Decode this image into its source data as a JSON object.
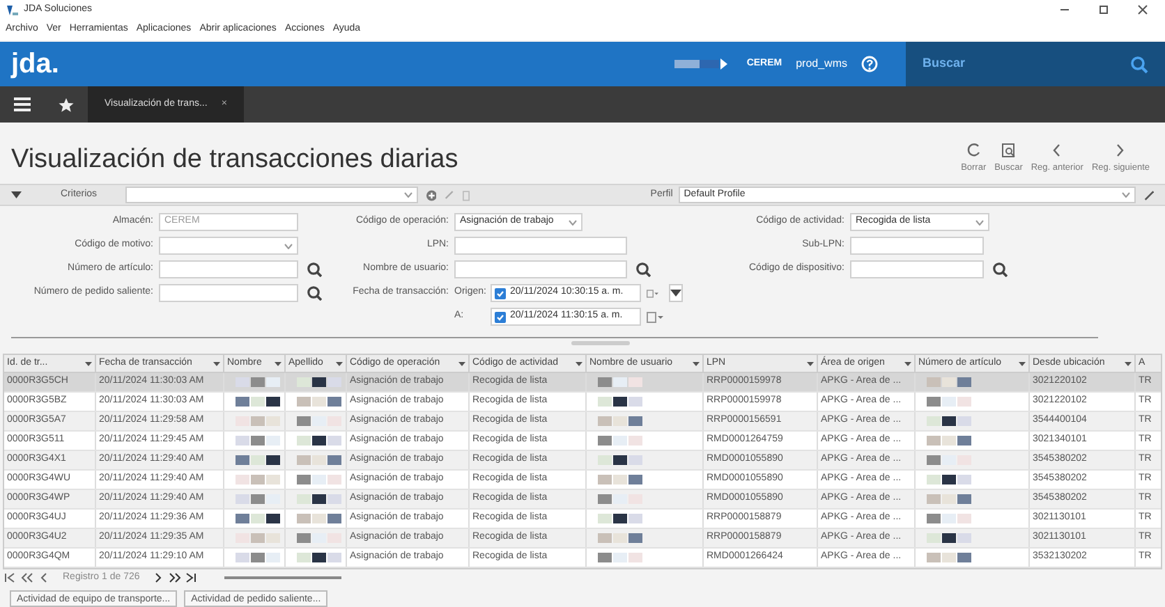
{
  "window": {
    "title": "JDA Soluciones"
  },
  "menu": [
    "Archivo",
    "Ver",
    "Herramientas",
    "Aplicaciones",
    "Abrir aplicaciones",
    "Acciones",
    "Ayuda"
  ],
  "header": {
    "logo": "jda.",
    "warehouse": "CEREM",
    "environment": "prod_wms",
    "search_label": "Buscar"
  },
  "tabs": [
    {
      "label": "Visualización de trans...",
      "close": "×",
      "selected": true
    }
  ],
  "page": {
    "title": "Visualización de transacciones diarias",
    "actions": [
      {
        "label": "Borrar",
        "kind": "clear"
      },
      {
        "label": "Buscar",
        "kind": "find"
      },
      {
        "label": "Reg. anterior",
        "kind": "prev"
      },
      {
        "label": "Reg. siguiente",
        "kind": "next"
      }
    ]
  },
  "criteria": {
    "label": "Criterios",
    "profile_label": "Perfil",
    "profile": "Default Profile"
  },
  "form": [
    [
      {
        "kind": "text",
        "label": "Almacén:",
        "value": "CEREM",
        "disabled": true
      },
      {
        "kind": "select",
        "label": "Código de motivo:"
      },
      {
        "kind": "lookup",
        "label": "Número de artículo:"
      },
      {
        "kind": "lookup",
        "label": "Número de pedido saliente:"
      }
    ],
    [
      {
        "kind": "select",
        "label": "Código de operación:",
        "value": "Asignación de trabajo"
      },
      {
        "kind": "text",
        "label": "LPN:"
      },
      {
        "kind": "lookup",
        "label": "Nombre de usuario:"
      },
      {
        "kind": "date",
        "label": "Fecha de transacción:",
        "prefix": "Origen:",
        "value": "20/11/2024 10:30:15 a. m.",
        "checked": true,
        "expander": true
      },
      {
        "kind": "date",
        "prefix": "A:",
        "value": "20/11/2024 11:30:15 a. m.",
        "checked": true
      }
    ],
    [
      {
        "kind": "select",
        "label": "Código de actividad:",
        "value": "Recogida de lista"
      },
      {
        "kind": "text",
        "label": "Sub-LPN:"
      },
      {
        "kind": "lookup",
        "label": "Código de dispositivo:"
      }
    ]
  ],
  "grid": {
    "columns": [
      {
        "label": "Id. de tr...",
        "kind": "text"
      },
      {
        "label": "Fecha de transacción",
        "kind": "text"
      },
      {
        "label": "Nombre",
        "kind": "redacted"
      },
      {
        "label": "Apellido",
        "kind": "redacted"
      },
      {
        "label": "Código de operación",
        "kind": "text"
      },
      {
        "label": "Código de actividad",
        "kind": "text"
      },
      {
        "label": "Nombre de usuario",
        "kind": "redacted"
      },
      {
        "label": "LPN",
        "kind": "text"
      },
      {
        "label": "Área de origen",
        "kind": "text"
      },
      {
        "label": "Número de artículo",
        "kind": "redacted"
      },
      {
        "label": "Desde ubicación",
        "kind": "text"
      },
      {
        "label": "A",
        "kind": "text"
      }
    ],
    "rows": [
      {
        "selected": true,
        "cells": [
          "0000R3G5CH",
          "20/11/2024 11:30:03 AM",
          "",
          "",
          "Asignación de trabajo",
          "Recogida de lista",
          "",
          "RRP0000159978",
          "APKG - Area de ...",
          "",
          "3021220102",
          "TR"
        ]
      },
      {
        "selected": false,
        "cells": [
          "0000R3G5BZ",
          "20/11/2024 11:30:03 AM",
          "",
          "",
          "Asignación de trabajo",
          "Recogida de lista",
          "",
          "RRP0000159978",
          "APKG - Area de ...",
          "",
          "3021220102",
          "TR"
        ]
      },
      {
        "selected": false,
        "cells": [
          "0000R3G5A7",
          "20/11/2024 11:29:58 AM",
          "",
          "",
          "Asignación de trabajo",
          "Recogida de lista",
          "",
          "RRP0000156591",
          "APKG - Area de ...",
          "",
          "3544400104",
          "TR"
        ]
      },
      {
        "selected": false,
        "cells": [
          "0000R3G511",
          "20/11/2024 11:29:45 AM",
          "",
          "",
          "Asignación de trabajo",
          "Recogida de lista",
          "",
          "RMD0001264759",
          "APKG - Area de ...",
          "",
          "3021340101",
          "TR"
        ]
      },
      {
        "selected": false,
        "cells": [
          "0000R3G4X1",
          "20/11/2024 11:29:40 AM",
          "",
          "",
          "Asignación de trabajo",
          "Recogida de lista",
          "",
          "RMD0001055890",
          "APKG - Area de ...",
          "",
          "3545380202",
          "TR"
        ]
      },
      {
        "selected": false,
        "cells": [
          "0000R3G4WU",
          "20/11/2024 11:29:40 AM",
          "",
          "",
          "Asignación de trabajo",
          "Recogida de lista",
          "",
          "RMD0001055890",
          "APKG - Area de ...",
          "",
          "3545380202",
          "TR"
        ]
      },
      {
        "selected": false,
        "cells": [
          "0000R3G4WP",
          "20/11/2024 11:29:40 AM",
          "",
          "",
          "Asignación de trabajo",
          "Recogida de lista",
          "",
          "RMD0001055890",
          "APKG - Area de ...",
          "",
          "3545380202",
          "TR"
        ]
      },
      {
        "selected": false,
        "cells": [
          "0000R3G4UJ",
          "20/11/2024 11:29:36 AM",
          "",
          "",
          "Asignación de trabajo",
          "Recogida de lista",
          "",
          "RRP0000158879",
          "APKG - Area de ...",
          "",
          "3021130101",
          "TR"
        ]
      },
      {
        "selected": false,
        "cells": [
          "0000R3G4U2",
          "20/11/2024 11:29:35 AM",
          "",
          "",
          "Asignación de trabajo",
          "Recogida de lista",
          "",
          "RRP0000158879",
          "APKG - Area de ...",
          "",
          "3021130101",
          "TR"
        ]
      },
      {
        "selected": false,
        "cells": [
          "0000R3G4QM",
          "20/11/2024 11:29:10 AM",
          "",
          "",
          "Asignación de trabajo",
          "Recogida de lista",
          "",
          "RMD0001266424",
          "APKG - Area de ...",
          "",
          "3532130202",
          "TR"
        ]
      }
    ],
    "pager": "Registro 1 de 726"
  },
  "buttons": [
    "Actividad de equipo de transporte...",
    "Actividad de pedido saliente..."
  ]
}
